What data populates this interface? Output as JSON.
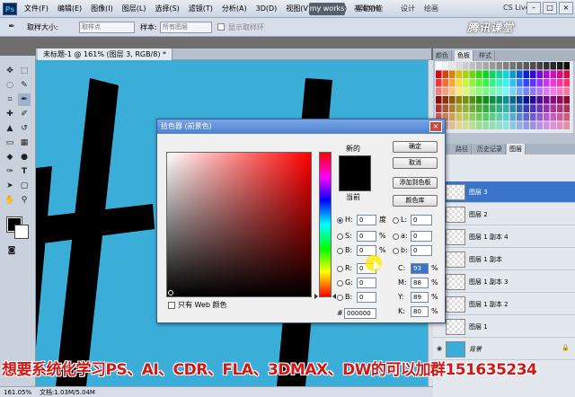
{
  "app": {
    "logo": "Ps",
    "menus": [
      "文件(F)",
      "编辑(E)",
      "图像(I)",
      "图层(L)",
      "选择(S)",
      "滤镜(T)",
      "分析(A)",
      "3D(D)",
      "视图(V)",
      "窗口(W)",
      "帮助(H)"
    ],
    "workspace_button": "my works",
    "workspace_items": [
      "基本功能",
      "设计",
      "绘画"
    ],
    "cslive": "CS Live",
    "watermark": "腾讯课堂"
  },
  "options": {
    "sample_size_label": "取样大小:",
    "sample_size_value": "取样点",
    "sample_label": "样本:",
    "sample_value": "所有图层",
    "show_ring_label": "显示取样环"
  },
  "document": {
    "tab_title": "未标题-1 @ 161% (图层 3, RGB/8) *",
    "status_zoom": "161.05%",
    "status_doc": "文档:1.03M/5.04M"
  },
  "panels": {
    "top_tabs": [
      "颜色",
      "色板",
      "样式"
    ],
    "top_active": 1,
    "mid_tabs": [
      "路径",
      "历史记录",
      "图层"
    ],
    "mid_active": 2,
    "layers": [
      {
        "name": "图层 3",
        "selected": true
      },
      {
        "name": "图层 2",
        "selected": false
      },
      {
        "name": "图层 1 副本 4",
        "selected": false
      },
      {
        "name": "图层 1 副本",
        "selected": false
      },
      {
        "name": "图层 1 副本 3",
        "selected": false
      },
      {
        "name": "图层 1 副本 2",
        "selected": false
      },
      {
        "name": "图层 1",
        "selected": false
      },
      {
        "name": "背景",
        "selected": false
      }
    ]
  },
  "dialog": {
    "title": "拾色器 (前景色)",
    "close": "×",
    "new_label": "新的",
    "current_label": "当前",
    "buttons": {
      "ok": "确定",
      "cancel": "取消",
      "add_swatch": "添加到色板",
      "libraries": "颜色库"
    },
    "hsb": [
      {
        "key": "H:",
        "value": "0",
        "unit": "度"
      },
      {
        "key": "S:",
        "value": "0",
        "unit": "%"
      },
      {
        "key": "B:",
        "value": "0",
        "unit": "%"
      }
    ],
    "rgb": [
      {
        "key": "R:",
        "value": "0"
      },
      {
        "key": "G:",
        "value": "0"
      },
      {
        "key": "B:",
        "value": "0"
      }
    ],
    "lab": [
      {
        "key": "L:",
        "value": "0"
      },
      {
        "key": "a:",
        "value": "0"
      },
      {
        "key": "b:",
        "value": "0"
      }
    ],
    "cmyk": [
      {
        "key": "C:",
        "value": "93",
        "unit": "%"
      },
      {
        "key": "M:",
        "value": "88",
        "unit": "%"
      },
      {
        "key": "Y:",
        "value": "89",
        "unit": "%"
      },
      {
        "key": "K:",
        "value": "80",
        "unit": "%"
      }
    ],
    "hex_prefix": "#",
    "hex_value": "000000",
    "web_only_label": "只有 Web 颜色"
  },
  "overlay_text": "想要系统化学习PS、AI、CDR、FLA、3DMAX、DW的可以加群151635234"
}
